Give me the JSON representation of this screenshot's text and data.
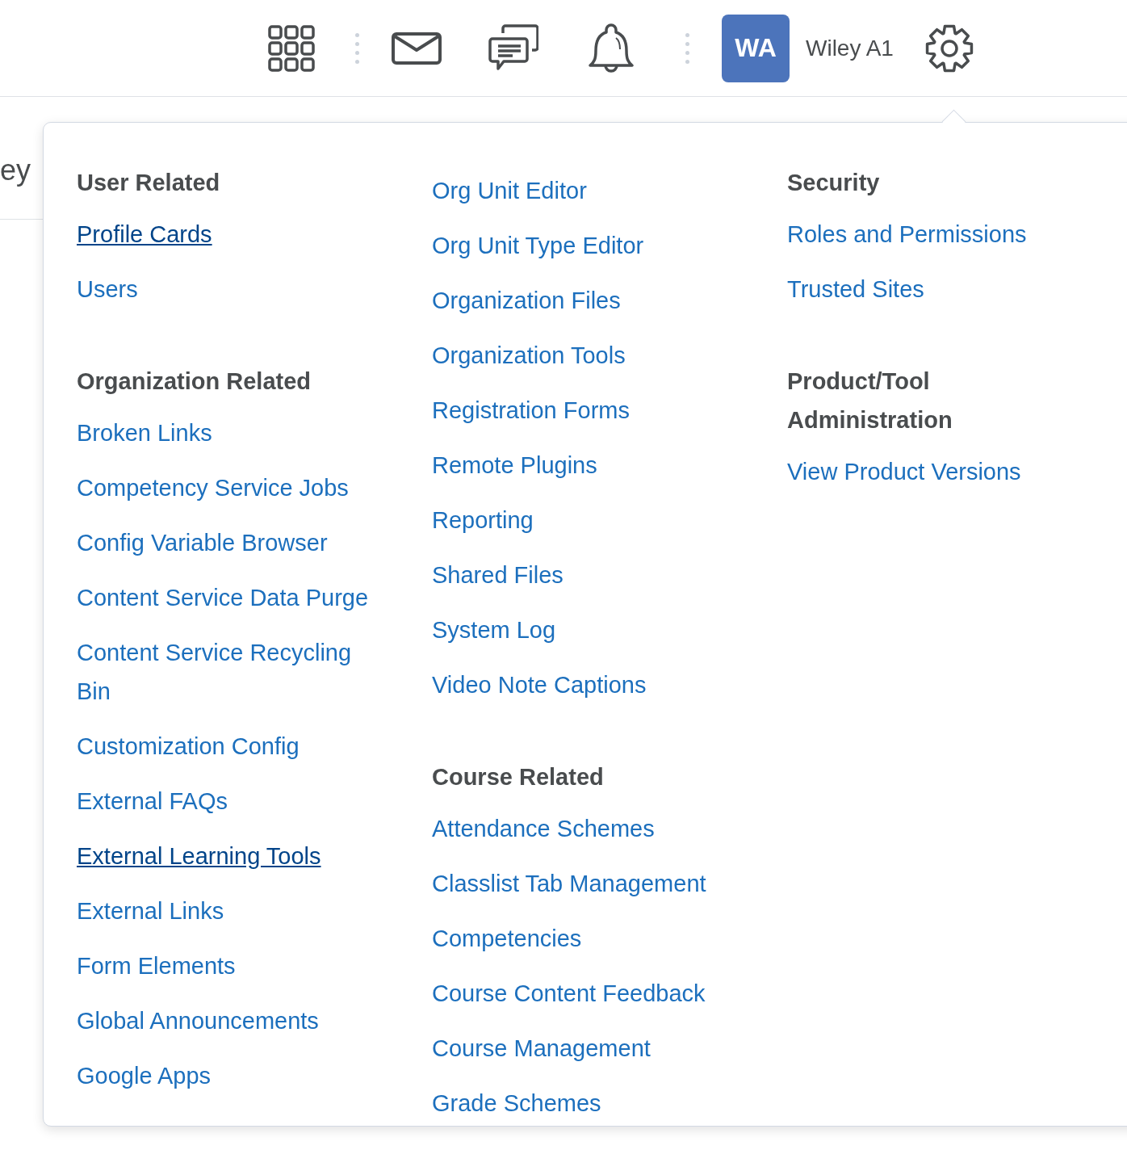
{
  "toolbar": {
    "avatar": "WA",
    "user_name": "Wiley A1"
  },
  "background_text": "ey",
  "menu": {
    "columns": [
      {
        "sections": [
          {
            "heading": "User Related",
            "links": [
              {
                "label": "Profile Cards",
                "underlined": true
              },
              {
                "label": "Users",
                "underlined": false
              }
            ]
          },
          {
            "heading": "Organization Related",
            "links": [
              {
                "label": "Broken Links",
                "underlined": false
              },
              {
                "label": "Competency Service Jobs",
                "underlined": false
              },
              {
                "label": "Config Variable Browser",
                "underlined": false
              },
              {
                "label": "Content Service Data Purge",
                "underlined": false
              },
              {
                "label": "Content Service Recycling Bin",
                "underlined": false
              },
              {
                "label": "Customization Config",
                "underlined": false
              },
              {
                "label": "External FAQs",
                "underlined": false
              },
              {
                "label": "External Learning Tools",
                "underlined": true
              },
              {
                "label": "External Links",
                "underlined": false
              },
              {
                "label": "Form Elements",
                "underlined": false
              },
              {
                "label": "Global Announcements",
                "underlined": false
              },
              {
                "label": "Google Apps",
                "underlined": false
              }
            ]
          }
        ]
      },
      {
        "sections": [
          {
            "links": [
              {
                "label": "Org Unit Editor",
                "underlined": false
              },
              {
                "label": "Org Unit Type Editor",
                "underlined": false
              },
              {
                "label": "Organization Files",
                "underlined": false
              },
              {
                "label": "Organization Tools",
                "underlined": false
              },
              {
                "label": "Registration Forms",
                "underlined": false
              },
              {
                "label": "Remote Plugins",
                "underlined": false
              },
              {
                "label": "Reporting",
                "underlined": false
              },
              {
                "label": "Shared Files",
                "underlined": false
              },
              {
                "label": "System Log",
                "underlined": false
              },
              {
                "label": "Video Note Captions",
                "underlined": false
              }
            ]
          },
          {
            "heading": "Course Related",
            "links": [
              {
                "label": "Attendance Schemes",
                "underlined": false
              },
              {
                "label": "Classlist Tab Management",
                "underlined": false
              },
              {
                "label": "Competencies",
                "underlined": false
              },
              {
                "label": "Course Content Feedback",
                "underlined": false
              },
              {
                "label": "Course Management",
                "underlined": false
              },
              {
                "label": "Grade Schemes",
                "underlined": false
              }
            ]
          }
        ]
      },
      {
        "sections": [
          {
            "heading": "Security",
            "links": [
              {
                "label": "Roles and Permissions",
                "underlined": false
              },
              {
                "label": "Trusted Sites",
                "underlined": false
              }
            ]
          },
          {
            "heading": "Product/Tool Administration",
            "links": [
              {
                "label": "View Product Versions",
                "underlined": false
              }
            ]
          }
        ]
      }
    ]
  }
}
